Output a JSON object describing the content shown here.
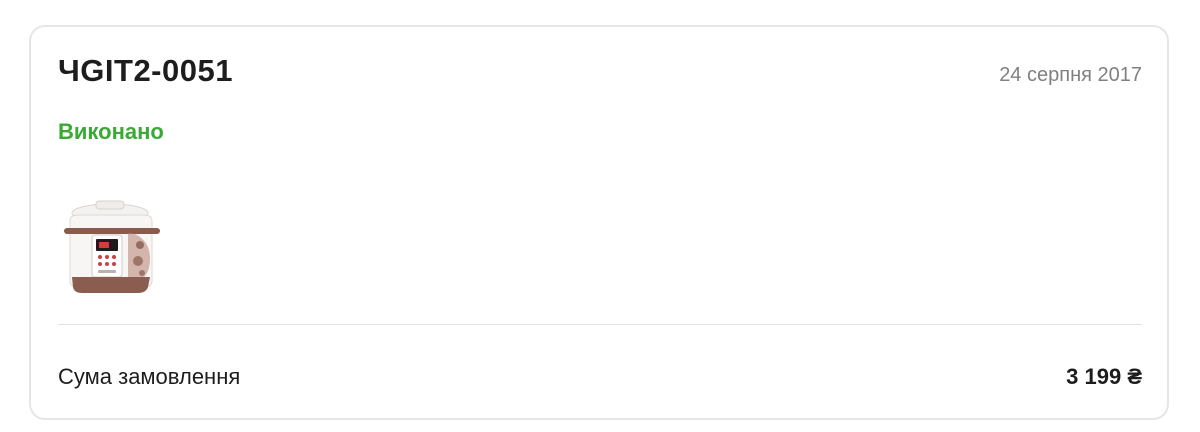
{
  "order": {
    "id": "ЧGIT2-0051",
    "date": "24 серпня 2017",
    "status": "Виконано",
    "status_color": "#3aa935",
    "product_image": "multicooker-product-image",
    "total_label": "Сума замовлення",
    "total_value": "3 199 ₴"
  }
}
